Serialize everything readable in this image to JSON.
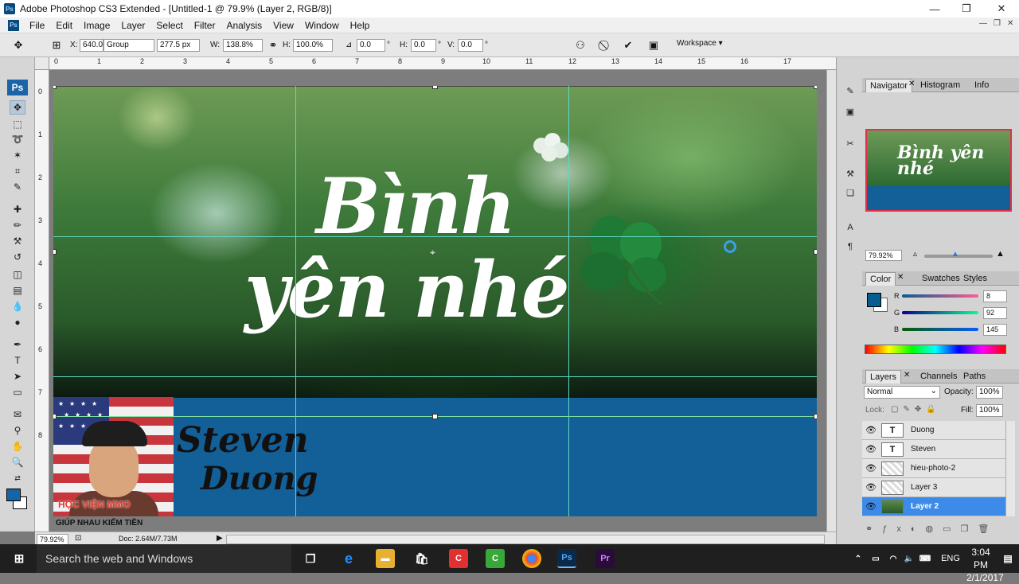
{
  "window": {
    "title": "Adobe Photoshop CS3 Extended - [Untitled-1 @ 79.9% (Layer 2, RGB/8)]",
    "minimize": "—",
    "restore": "❐",
    "close": "✕"
  },
  "menu": [
    "File",
    "Edit",
    "Image",
    "Layer",
    "Select",
    "Filter",
    "Analysis",
    "View",
    "Window",
    "Help"
  ],
  "options": {
    "x_label": "X:",
    "x_value": "640.0",
    "group_value": "Group",
    "y_value": "277.5 px",
    "w_label": "W:",
    "w_value": "138.8%",
    "h_label": "H:",
    "h_value": "100.0%",
    "angle_value": "0.0",
    "hskew_label": "H:",
    "hskew_value": "0.0",
    "vskew_label": "V:",
    "vskew_value": "0.0",
    "degree": "°",
    "workspace": "Workspace ▾"
  },
  "ruler": {
    "h_ticks": [
      "0",
      "1",
      "2",
      "3",
      "4",
      "5",
      "6",
      "7",
      "8",
      "9",
      "10",
      "11",
      "12",
      "13",
      "14",
      "15",
      "16",
      "17"
    ],
    "v_ticks": [
      "0",
      "1",
      "2",
      "3",
      "4",
      "5",
      "6",
      "7",
      "8"
    ]
  },
  "canvas": {
    "title_line1": "Bình",
    "title_line2": "yên nhé",
    "signature_line1": "Steven",
    "signature_line2": "Duong",
    "watermark": "GIÚP NHAU KIẾM TIỀN",
    "logo_text": "HỌC VIỆN MMO"
  },
  "status": {
    "zoom": "79.92%",
    "doc": "Doc: 2.64M/7.73M"
  },
  "navigator": {
    "tabs": [
      "Navigator",
      "Histogram",
      "Info"
    ],
    "zoom": "79.92%",
    "thumb_text": "Bình yên nhé"
  },
  "color_panel": {
    "tabs": [
      "Color",
      "Swatches",
      "Styles"
    ],
    "r_label": "R",
    "g_label": "G",
    "b_label": "B",
    "r": "8",
    "g": "92",
    "b": "145",
    "foreground": "#085c91"
  },
  "layers_panel": {
    "tabs": [
      "Layers",
      "Channels",
      "Paths"
    ],
    "blend_mode": "Normal",
    "opacity_label": "Opacity:",
    "opacity": "100%",
    "lock_label": "Lock:",
    "fill_label": "Fill:",
    "fill": "100%",
    "layers": [
      {
        "name": "Duong",
        "type": "T"
      },
      {
        "name": "Steven",
        "type": "T"
      },
      {
        "name": "hieu-photo-2",
        "type": ""
      },
      {
        "name": "Layer 3",
        "type": ""
      },
      {
        "name": "Layer 2",
        "type": "",
        "selected": true
      }
    ]
  },
  "taskbar": {
    "search_placeholder": "Search the web and Windows",
    "language": "ENG",
    "time": "3:04 PM",
    "date": "2/1/2017"
  }
}
